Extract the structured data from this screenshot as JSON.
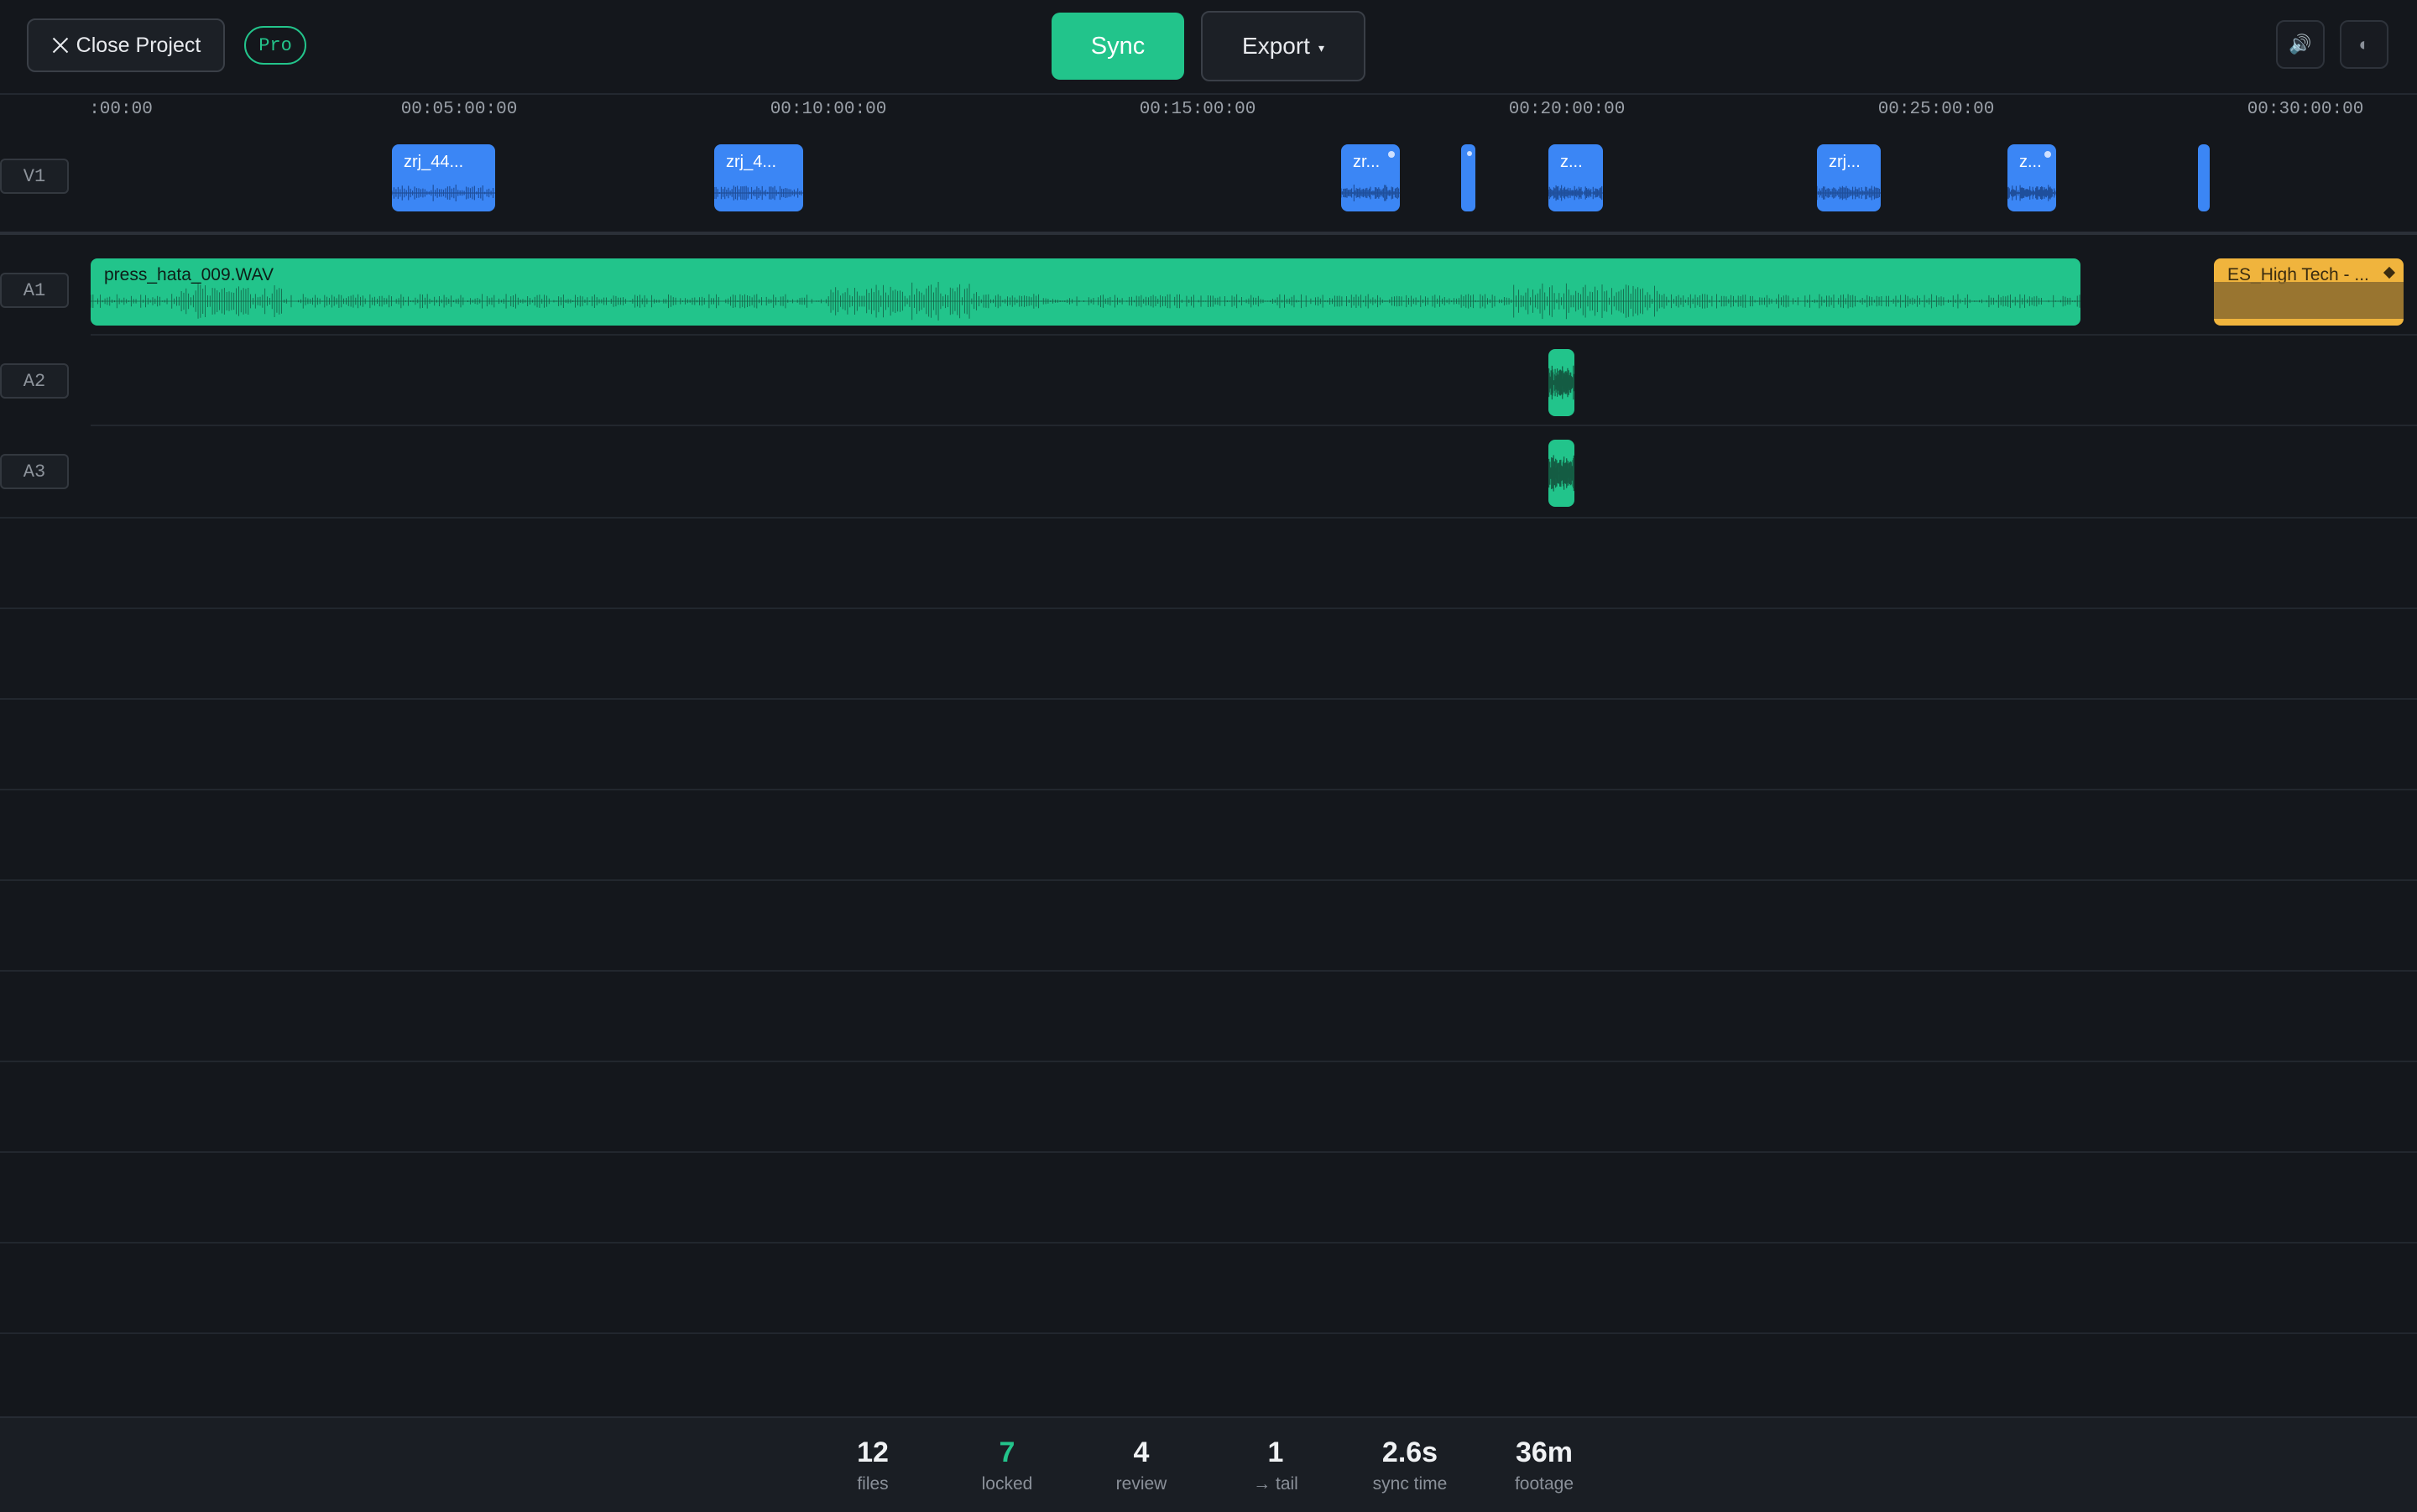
{
  "toolbar": {
    "close_label": "Close Project",
    "badge": "Pro",
    "sync_label": "Sync",
    "export_label": "Export",
    "export_caret": "▾",
    "volume_icon": "🔊",
    "theme_icon": "◐"
  },
  "ruler": {
    "ticks": [
      ":00:00",
      "00:05:00:00",
      "00:10:00:00",
      "00:15:00:00",
      "00:20:00:00",
      "00:25:00:00",
      "00:30:00:00"
    ]
  },
  "tracks": {
    "v1": {
      "label": "V1",
      "clips": [
        "zrj_44...",
        "zrj_4...",
        "zr...",
        "",
        "z...",
        "zrj...",
        "z...",
        ""
      ]
    },
    "a1": {
      "label": "A1",
      "clip": "press_hata_009.WAV",
      "music_clip": "ES_High Tech - ..."
    },
    "a2": {
      "label": "A2"
    },
    "a3": {
      "label": "A3"
    }
  },
  "stats": [
    {
      "value": "12",
      "label": "files"
    },
    {
      "value": "7",
      "label": "locked"
    },
    {
      "value": "4",
      "label": "review"
    },
    {
      "value": "1",
      "label": "→ tail"
    },
    {
      "value": "2.6s",
      "label": "sync time"
    },
    {
      "value": "36m",
      "label": "footage"
    }
  ],
  "colors": {
    "background": "#14171c",
    "accent": "#22c48b",
    "video_clip": "#3b86f5",
    "music_clip": "#f0b43d"
  }
}
